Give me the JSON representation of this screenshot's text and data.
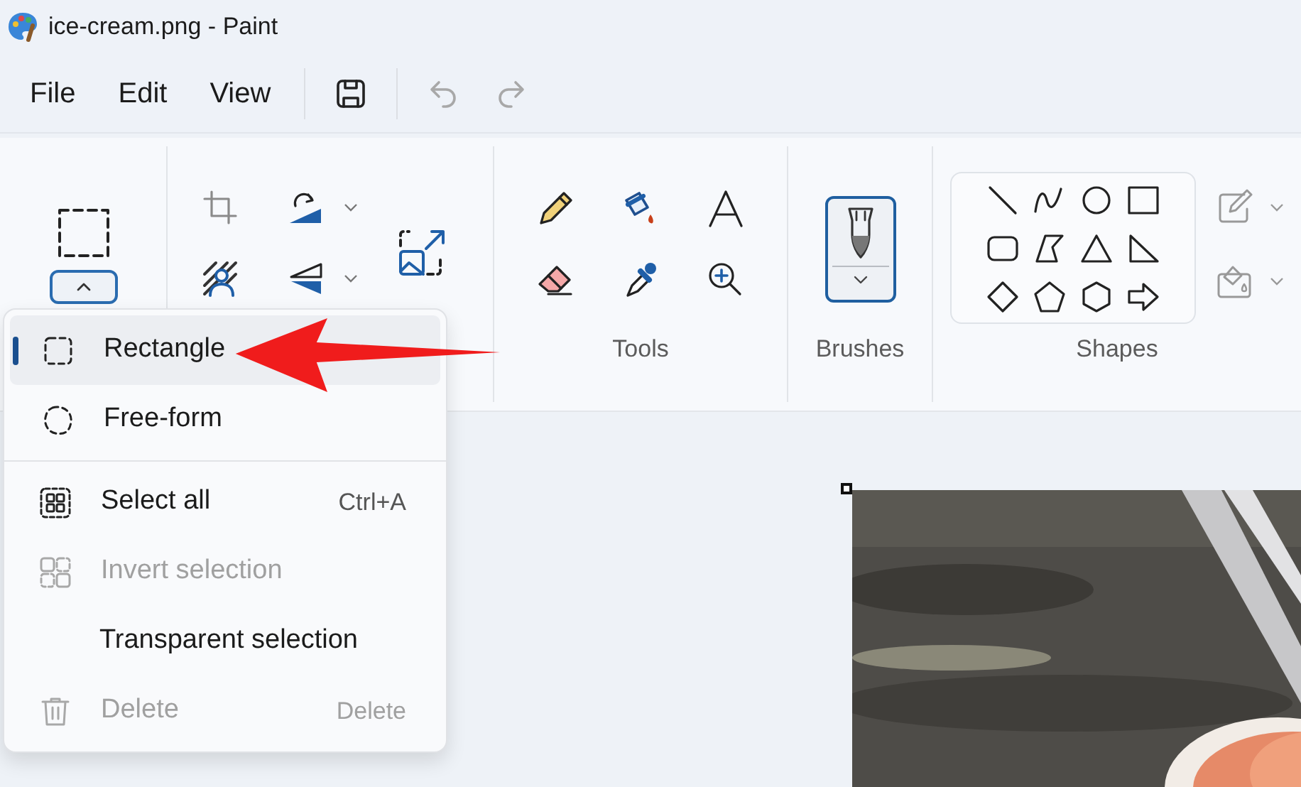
{
  "window": {
    "title": "ice-cream.png - Paint"
  },
  "menu_bar": {
    "items": [
      "File",
      "Edit",
      "View"
    ]
  },
  "quick_actions": [
    {
      "kind": "save",
      "disabled": false
    },
    {
      "kind": "undo",
      "disabled": true
    },
    {
      "kind": "redo",
      "disabled": true
    }
  ],
  "ribbon": {
    "selection_expanded": true,
    "group_labels": [
      "Tools",
      "Brushes",
      "Shapes"
    ]
  },
  "selection_menu": {
    "items": [
      {
        "kind": "rectangle",
        "label": "Rectangle",
        "selected": true,
        "disabled": false
      },
      {
        "kind": "freeform",
        "label": "Free-form",
        "selected": false,
        "disabled": false
      },
      {
        "kind": "separator"
      },
      {
        "kind": "select-all",
        "label": "Select all",
        "shortcut": "Ctrl+A",
        "disabled": false
      },
      {
        "kind": "invert",
        "label": "Invert selection",
        "disabled": true
      },
      {
        "kind": "none",
        "label": "Transparent selection",
        "disabled": false
      },
      {
        "kind": "delete",
        "label": "Delete",
        "shortcut": "Delete",
        "disabled": true
      }
    ]
  }
}
